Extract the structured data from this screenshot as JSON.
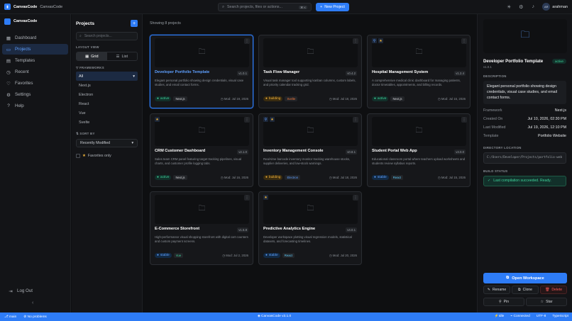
{
  "app": {
    "logo_text": "CanvasCode",
    "workspace": "CanvasCode"
  },
  "topbar": {
    "search_placeholder": "Search projects, files or actions...",
    "shortcut": "⌘ K",
    "new_project_label": "New Project",
    "user_initials": "AR",
    "user_name": "arahman"
  },
  "sidebar": {
    "brand": "CanvasCode",
    "items": [
      {
        "label": "Dashboard",
        "icon": "grid-icon"
      },
      {
        "label": "Projects",
        "icon": "folder-icon",
        "active": true
      },
      {
        "label": "Templates",
        "icon": "template-icon"
      },
      {
        "label": "Recent",
        "icon": "clock-icon"
      },
      {
        "label": "Favorites",
        "icon": "heart-icon"
      },
      {
        "label": "Settings",
        "icon": "gear-icon"
      },
      {
        "label": "Help",
        "icon": "help-icon"
      }
    ],
    "logout": "Log Out"
  },
  "filters": {
    "title": "Projects",
    "search_placeholder": "Search projects...",
    "layout_label": "LAYOUT VIEW",
    "grid_label": "Grid",
    "list_label": "List",
    "frameworks_label": "FRAMEWORKS",
    "frameworks": [
      "All",
      "Next.js",
      "Electron",
      "React",
      "Vue",
      "Svelte"
    ],
    "sort_label": "SORT BY",
    "sort_value": "Recently Modified",
    "favorites_label": "Favorites only"
  },
  "main": {
    "showing": "Showing 8 projects",
    "projects": [
      {
        "title": "Developer Portfolio Template",
        "version": "v1.0.1",
        "desc": "Elegant personal portfolio showing design credentials, visual case studies, and email contact forms.",
        "status": "active",
        "framework": "Next.js",
        "modified": "Mod: Jul 19, 2026"
      },
      {
        "title": "Task Flow Manager",
        "version": "v0.4.2",
        "desc": "Visual task manager tool supporting kanban columns, custom labels, and priority calendar tracking grid.",
        "status": "building",
        "framework": "Svelte",
        "modified": "Mod: Jul 18, 2026"
      },
      {
        "title": "Hospital Management System",
        "version": "v1.2.4",
        "desc": "A comprehensive medical clinic dashboard for managing patients, doctor timetables, appointments, and billing records.",
        "status": "active",
        "framework": "Next.js",
        "modified": "Mod: Jul 15, 2026"
      },
      {
        "title": "CRM Customer Dashboard",
        "version": "v2.1.0",
        "desc": "Sales team CRM panel featuring target tracking pipelines, visual charts, and customer profile logging tabs.",
        "status": "active",
        "framework": "Next.js",
        "modified": "Mod: Jul 16, 2026"
      },
      {
        "title": "Inventory Management Console",
        "version": "v0.8.1",
        "desc": "Real-time barcode inventory monitor tracking warehouse stocks, supplier deliveries, and low-stock warnings.",
        "status": "building",
        "framework": "Electron",
        "modified": "Mod: Jul 18, 2026"
      },
      {
        "title": "Student Portal Web App",
        "version": "v3.0.0",
        "desc": "Educational classroom portal where teachers upload worksheets and students review syllabus reports.",
        "status": "stable",
        "framework": "React",
        "modified": "Mod: Jul 15, 2026"
      },
      {
        "title": "E-Commerce Storefront",
        "version": "v1.5.8",
        "desc": "High-performance visual shopping storefront with digital cart counters and custom payment screens.",
        "status": "stable",
        "framework": "Vue",
        "modified": "Mod: Jul 2, 2026"
      },
      {
        "title": "Predictive Analytics Engine",
        "version": "v4.0.1",
        "desc": "Developer workspace plotting visual regression models, statistical datasets, and forecasting timelines.",
        "status": "stable",
        "framework": "React",
        "modified": "Mod: Jul 20, 2026"
      }
    ]
  },
  "detail": {
    "title": "Developer Portfolio Template",
    "badge": "active",
    "version": "v1.0.1",
    "desc_label": "DESCRIPTION",
    "desc": "Elegant personal portfolio showing design credentials, visual case studies, and email contact forms.",
    "rows": [
      {
        "k": "Framework",
        "v": "Next.js"
      },
      {
        "k": "Created On",
        "v": "Jul 10, 2026, 02:30 PM"
      },
      {
        "k": "Last Modified",
        "v": "Jul 19, 2026, 12:10 PM"
      },
      {
        "k": "Template",
        "v": "Portfolio Website"
      }
    ],
    "dir_label": "DIRECTORY LOCATION",
    "dir": "C:/Users/Developer/Projects/portfolio-web",
    "build_label": "BUILD STATUS",
    "build": "Last compilation succeeded. Ready.",
    "open": "Open Workspace",
    "rename": "Rename",
    "clone": "Clone",
    "delete": "Delete",
    "pin": "Pin",
    "star": "Star"
  },
  "statusbar": {
    "branch": "main",
    "problems": "No problems",
    "center": "CanvasCode v3.1.0",
    "idle": "Idle",
    "connected": "Connected",
    "encoding": "UTF-8",
    "lang": "TypeScript"
  },
  "colors": {
    "accent": "#2e7cf6",
    "active": "#3ed39a",
    "building": "#f2b33d"
  }
}
